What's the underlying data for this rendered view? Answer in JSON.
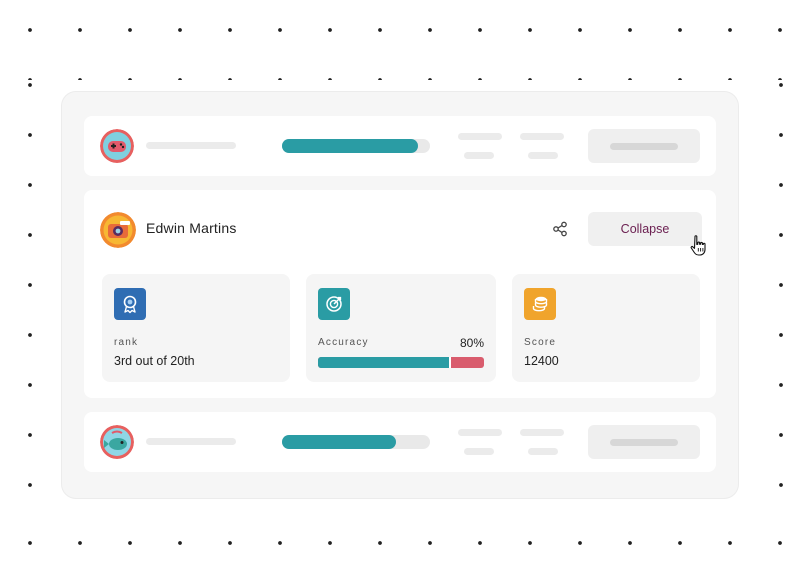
{
  "user": {
    "name": "Edwin Martins"
  },
  "actions": {
    "collapse_label": "Collapse"
  },
  "stats": {
    "rank": {
      "label": "rank",
      "value": "3rd out of 20th",
      "icon": "award-ribbon-icon",
      "color": "#2f6db3"
    },
    "accuracy": {
      "label": "Accuracy",
      "percent_text": "80%",
      "correct_fraction": 0.8,
      "icon": "target-icon",
      "color": "#2a9ca4"
    },
    "score": {
      "label": "Score",
      "value": "12400",
      "icon": "coin-stack-icon",
      "color": "#f0a42c"
    }
  },
  "placeholder_rows": [
    {
      "progress_fraction": 0.92,
      "avatar_icon": "game-controller-avatar-icon"
    },
    {
      "progress_fraction": 0.77,
      "avatar_icon": "fish-avatar-icon"
    }
  ],
  "colors": {
    "accent_teal": "#2a9ca4",
    "error_red": "#d95c6d",
    "collapse_text": "#6c2152"
  }
}
